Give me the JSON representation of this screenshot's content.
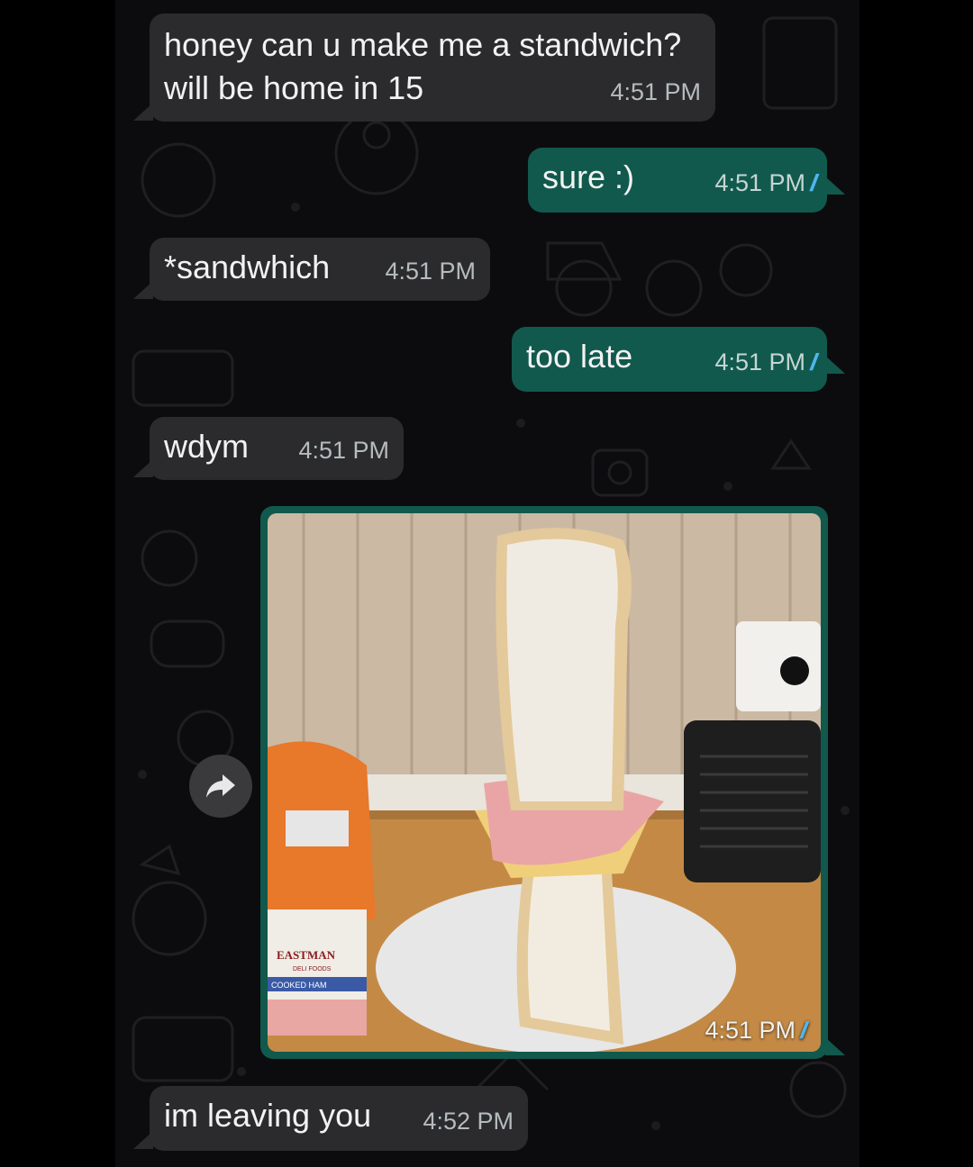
{
  "messages": [
    {
      "id": "m1",
      "direction": "incoming",
      "text_line1": "honey can u make me a standwich?",
      "text_line2": "will be home in 15",
      "time": "4:51 PM"
    },
    {
      "id": "m2",
      "direction": "outgoing",
      "text": "sure :)",
      "time": "4:51 PM",
      "status": "read"
    },
    {
      "id": "m3",
      "direction": "incoming",
      "text": "*sandwhich",
      "time": "4:51 PM"
    },
    {
      "id": "m4",
      "direction": "outgoing",
      "text": "too late",
      "time": "4:51 PM",
      "status": "read"
    },
    {
      "id": "m5",
      "direction": "incoming",
      "text": "wdym",
      "time": "4:51 PM"
    },
    {
      "id": "m6",
      "direction": "outgoing",
      "type": "image",
      "time": "4:51 PM",
      "status": "read"
    },
    {
      "id": "m7",
      "direction": "incoming",
      "text": "im leaving you",
      "time": "4:52 PM"
    }
  ],
  "photo_labels": {
    "brand": "EASTMAN",
    "sub": "DELI FOODS",
    "product": "COOKED HAM"
  },
  "icons": {
    "forward": "forward-arrow-icon",
    "read_receipt": "double-check-icon"
  },
  "colors": {
    "background": "#0c0c0e",
    "incoming_bubble": "#2b2b2d",
    "outgoing_bubble": "#11594d",
    "read_ticks": "#4fb6ec"
  }
}
